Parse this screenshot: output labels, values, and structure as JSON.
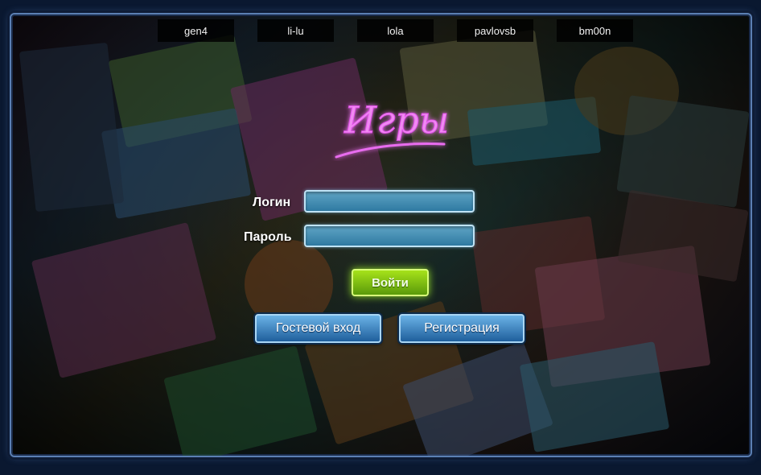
{
  "users": [
    "gen4",
    "li-lu",
    "lola",
    "pavlovsb",
    "bm00n"
  ],
  "logo": {
    "text": "Игры",
    "color": "#e04ee8"
  },
  "form": {
    "login_label": "Логин",
    "login_value": "",
    "password_label": "Пароль",
    "password_value": ""
  },
  "buttons": {
    "login": "Войти",
    "guest": "Гостевой вход",
    "register": "Регистрация"
  },
  "colors": {
    "accent_green": "#8ecf14",
    "accent_blue": "#3a86c4",
    "frame_border": "#5b7fb3"
  }
}
